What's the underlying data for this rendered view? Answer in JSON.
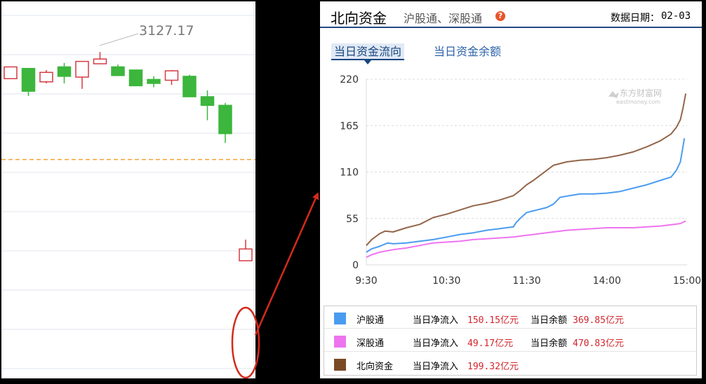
{
  "left_chart": {
    "label_value": "3127.17",
    "candles": [
      {
        "o": 3093,
        "c": 3108,
        "h": 3108,
        "l": 3093
      },
      {
        "o": 3106,
        "c": 3077,
        "h": 3106,
        "l": 3071
      },
      {
        "o": 3089,
        "c": 3101,
        "h": 3104,
        "l": 3087
      },
      {
        "o": 3108,
        "c": 3096,
        "h": 3113,
        "l": 3087
      },
      {
        "o": 3095,
        "c": 3115,
        "h": 3115,
        "l": 3080
      },
      {
        "o": 3112,
        "c": 3118,
        "h": 3127,
        "l": 3112
      },
      {
        "o": 3108,
        "c": 3097,
        "h": 3111,
        "l": 3097
      },
      {
        "o": 3104,
        "c": 3084,
        "h": 3104,
        "l": 3084
      },
      {
        "o": 3092,
        "c": 3087,
        "h": 3096,
        "l": 3082
      },
      {
        "o": 3091,
        "c": 3103,
        "h": 3104,
        "l": 3085
      },
      {
        "o": 3096,
        "c": 3070,
        "h": 3098,
        "l": 3070
      },
      {
        "o": 3070,
        "c": 3059,
        "h": 3078,
        "l": 3040
      },
      {
        "o": 3059,
        "c": 3023,
        "h": 3062,
        "l": 3011
      }
    ],
    "last_candle": {
      "o": 2861,
      "c": 2876,
      "h": 2888,
      "l": 2861
    },
    "reference_level": 2990,
    "colors": {
      "up": "#d43b44",
      "down": "#3cb63c",
      "reference": "#f2a33a",
      "grid": "#e2e6ee",
      "highlight": "#d42a1c"
    }
  },
  "header": {
    "title": "北向资金",
    "subtitle": "沪股通、深股通",
    "help_icon": "?",
    "date_label": "数据日期：",
    "date_value": "02-03"
  },
  "tabs": [
    {
      "label": "当日资金流向",
      "active": true
    },
    {
      "label": "当日资金余额",
      "active": false
    }
  ],
  "watermark": {
    "title": "东方财富网",
    "subtitle": "eastmoney.com"
  },
  "chart_data": {
    "type": "line",
    "title": "",
    "xlabel": "",
    "ylabel": "",
    "x_ticks": [
      "9:30",
      "10:30",
      "11:30",
      "14:00",
      "15:00"
    ],
    "y_ticks": [
      0,
      55,
      110,
      165,
      220
    ],
    "ylim": [
      0,
      220
    ],
    "x_range_minutes": [
      0,
      240
    ],
    "grid": "horizontal dashed",
    "series": [
      {
        "name": "沪股通",
        "color": "#4a9cf0",
        "points": [
          [
            0,
            15
          ],
          [
            4,
            19
          ],
          [
            10,
            22
          ],
          [
            16,
            26
          ],
          [
            20,
            25
          ],
          [
            30,
            26
          ],
          [
            40,
            28
          ],
          [
            50,
            30
          ],
          [
            60,
            33
          ],
          [
            70,
            36
          ],
          [
            80,
            38
          ],
          [
            90,
            41
          ],
          [
            100,
            43
          ],
          [
            110,
            45
          ],
          [
            112,
            50
          ],
          [
            115,
            55
          ],
          [
            120,
            62
          ],
          [
            125,
            64
          ],
          [
            135,
            68
          ],
          [
            140,
            72
          ],
          [
            145,
            80
          ],
          [
            152,
            82
          ],
          [
            160,
            84
          ],
          [
            170,
            84
          ],
          [
            180,
            85
          ],
          [
            190,
            87
          ],
          [
            200,
            91
          ],
          [
            210,
            95
          ],
          [
            220,
            100
          ],
          [
            228,
            104
          ],
          [
            232,
            112
          ],
          [
            235,
            122
          ],
          [
            238,
            150
          ]
        ]
      },
      {
        "name": "深股通",
        "color": "#ee74ef",
        "points": [
          [
            0,
            9
          ],
          [
            4,
            12
          ],
          [
            10,
            15
          ],
          [
            20,
            18
          ],
          [
            30,
            20
          ],
          [
            40,
            23
          ],
          [
            50,
            26
          ],
          [
            60,
            27
          ],
          [
            70,
            28
          ],
          [
            80,
            30
          ],
          [
            90,
            31
          ],
          [
            100,
            32
          ],
          [
            110,
            33
          ],
          [
            120,
            35
          ],
          [
            130,
            37
          ],
          [
            140,
            39
          ],
          [
            150,
            41
          ],
          [
            160,
            42
          ],
          [
            170,
            43
          ],
          [
            180,
            44
          ],
          [
            190,
            44
          ],
          [
            200,
            44
          ],
          [
            210,
            45
          ],
          [
            220,
            46
          ],
          [
            230,
            48
          ],
          [
            235,
            49
          ],
          [
            239,
            52
          ]
        ]
      },
      {
        "name": "北向资金",
        "color": "#94654a",
        "points": [
          [
            0,
            23
          ],
          [
            4,
            30
          ],
          [
            10,
            37
          ],
          [
            14,
            40
          ],
          [
            20,
            39
          ],
          [
            30,
            44
          ],
          [
            40,
            48
          ],
          [
            50,
            56
          ],
          [
            60,
            60
          ],
          [
            70,
            65
          ],
          [
            80,
            70
          ],
          [
            90,
            73
          ],
          [
            100,
            77
          ],
          [
            110,
            82
          ],
          [
            115,
            88
          ],
          [
            120,
            95
          ],
          [
            125,
            100
          ],
          [
            130,
            106
          ],
          [
            135,
            112
          ],
          [
            140,
            118
          ],
          [
            150,
            122
          ],
          [
            160,
            124
          ],
          [
            170,
            125
          ],
          [
            180,
            127
          ],
          [
            190,
            130
          ],
          [
            200,
            134
          ],
          [
            210,
            140
          ],
          [
            220,
            147
          ],
          [
            228,
            155
          ],
          [
            232,
            163
          ],
          [
            235,
            172
          ],
          [
            237,
            186
          ],
          [
            239,
            203
          ]
        ]
      }
    ]
  },
  "legend": [
    {
      "name": "沪股通",
      "color": "#4a9cf0",
      "inflow_label": "当日净流入",
      "inflow_value": "150.15亿元",
      "balance_label": "当日余额",
      "balance_value": "369.85亿元"
    },
    {
      "name": "深股通",
      "color": "#ee74ef",
      "inflow_label": "当日净流入",
      "inflow_value": "49.17亿元",
      "balance_label": "当日余额",
      "balance_value": "470.83亿元"
    },
    {
      "name": "北向资金",
      "color": "#7a4a26",
      "inflow_label": "当日净流入",
      "inflow_value": "199.32亿元"
    }
  ]
}
